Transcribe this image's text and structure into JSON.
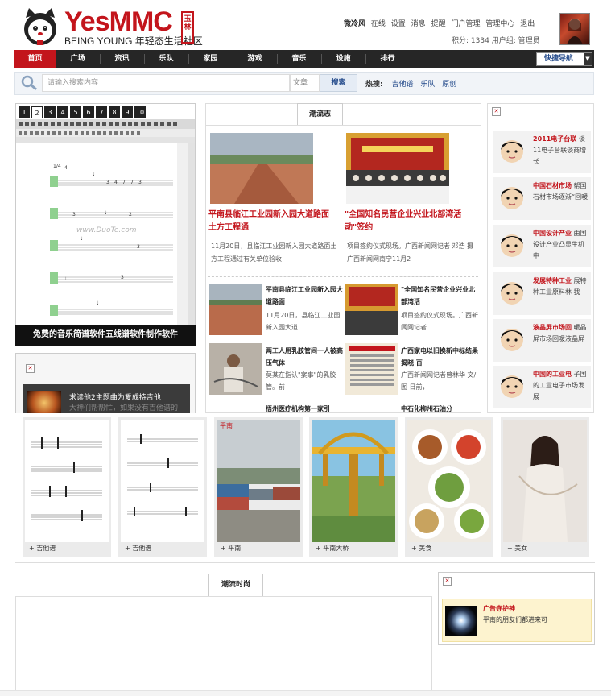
{
  "brand": {
    "logo_text": "YesMMC",
    "tagline": "BEING YOUNG 年轻态生活社区",
    "badge": "玉林"
  },
  "userbar": {
    "username": "微冷风",
    "status": "在线",
    "links": [
      "设置",
      "消息",
      "提醒",
      "门户管理",
      "管理中心",
      "退出"
    ],
    "points_label": "积分: 1334",
    "group_label": "用户组: 管理员"
  },
  "nav": {
    "items": [
      "首页",
      "广场",
      "资讯",
      "乐队",
      "家园",
      "游戏",
      "音乐",
      "设施",
      "排行"
    ],
    "active_index": 0,
    "quick_nav": "快捷导航",
    "active_color": "#c3151c"
  },
  "search": {
    "placeholder": "请输入搜索内容",
    "type": "文章",
    "button": "搜索",
    "hot_label": "热搜:",
    "hot_tags": [
      "吉他谱",
      "乐队",
      "原创"
    ]
  },
  "slider": {
    "pages": [
      "1",
      "2",
      "3",
      "4",
      "5",
      "6",
      "7",
      "8",
      "9",
      "10"
    ],
    "active_page": 1,
    "caption": "免费的音乐简谱软件五线谱软件制作软件",
    "watermark": "www.DuoTe.com"
  },
  "left_ad": {
    "title": "求读他2主题曲为爱成持吉他",
    "sub": "大神们帮帮忙，如果没有吉他谱的"
  },
  "center": {
    "tab": "潮流志",
    "featured": [
      {
        "title": "平南县临江工业园新入园大道路面土方工程通",
        "desc": "11月20日，县临江工业园新入园大道路面土方工程通过有关单位验收"
      },
      {
        "title": "\"全国知名民营企业兴业北部湾活动\"签约",
        "desc": "项目签约仪式现场。广西新闻网记者 邓浩 摄 广西新闻网南宁11月2"
      }
    ],
    "list": [
      {
        "title": "平南县临江工业园新入园大道路面",
        "desc": "11月20日，县临江工业园新入园大道"
      },
      {
        "title": "\"全国知名民营企业兴业北部湾活",
        "desc": "项目签约仪式现场。广西新闻网记者"
      },
      {
        "title": "两工人用乳胶管间一人被高压气体",
        "desc": "莫某在指认\"案事\"的乳胶管。前"
      },
      {
        "title": "广西家电以旧换新中标结果揭晓 百",
        "desc": "广西新闻网记者曾林华 文/图 日前，"
      },
      {
        "title": "梧州医疗机构第一家引",
        "desc": ""
      },
      {
        "title": "中石化柳州石油分",
        "desc": ""
      }
    ]
  },
  "right": {
    "cards": [
      {
        "title": "2011电子台联",
        "text": "谈11电子台联谈商增长"
      },
      {
        "title": "中国石材市场",
        "text": "帮国石材市场逐渐“回暖"
      },
      {
        "title": "中国设计产业",
        "text": "由国设计产业凸显生机 中"
      },
      {
        "title": "发展特种工业",
        "text": "展特种工业原料林 我"
      },
      {
        "title": "液晶屏市场回",
        "text": "暖晶屏市场回暖液晶屏"
      },
      {
        "title": "中国的工业电",
        "text": "子国的工业电子市场发展"
      }
    ]
  },
  "gallery": {
    "items": [
      {
        "label": "+ 吉他谱",
        "icon": "sheet-music"
      },
      {
        "label": "+ 吉他谱",
        "icon": "sheet-music"
      },
      {
        "label": "+ 平南",
        "icon": "containers-photo",
        "tag": "平南"
      },
      {
        "label": "+ 平南大桥",
        "icon": "bridge-photo"
      },
      {
        "label": "+ 美食",
        "icon": "food-photo"
      },
      {
        "label": "+ 美女",
        "icon": "portrait-photo"
      }
    ]
  },
  "bottom": {
    "tab": "潮流时尚",
    "promo_title": "广告寺护神",
    "promo_sub": "平南的朋友们都进来可"
  }
}
